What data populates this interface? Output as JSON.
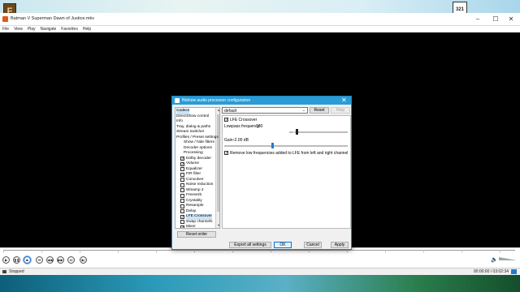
{
  "desktop": {
    "left_icon": "F",
    "right_icon": "321"
  },
  "window": {
    "title": "Batman V Superman Dawn of Justice.mkv",
    "icons": {
      "app": "mpc-app-icon",
      "minimize": "–",
      "maximize": "☐",
      "close": "✕"
    }
  },
  "menu": [
    "File",
    "View",
    "Play",
    "Navigate",
    "Favorites",
    "Help"
  ],
  "controls": {
    "buttons": [
      {
        "name": "play-button",
        "glyph": "▶"
      },
      {
        "name": "pause-button",
        "glyph": "❚❚"
      },
      {
        "name": "stop-button",
        "glyph": "■",
        "active": true
      },
      {
        "name": "previous-button",
        "glyph": "⏮"
      },
      {
        "name": "rewind-button",
        "glyph": "◀◀"
      },
      {
        "name": "forward-button",
        "glyph": "▶▶"
      },
      {
        "name": "next-button",
        "glyph": "⏭"
      },
      {
        "name": "frame-step-button",
        "glyph": "▶|"
      }
    ],
    "volume_icon": "🔈",
    "volume_level": 1.0
  },
  "status": {
    "state": "Stopped",
    "time": "00:00:00 / 03:02:34"
  },
  "dialog": {
    "title": "ffdshow audio processor configuration",
    "close_glyph": "✕",
    "tree": {
      "items": [
        {
          "label": "Codecs",
          "level": 1,
          "selected": true
        },
        {
          "label": "DirectShow control",
          "level": 1
        },
        {
          "label": "Info",
          "level": 1
        },
        {
          "label": "Tray, dialog & paths",
          "level": 1
        },
        {
          "label": "Stream switcher",
          "level": 1
        },
        {
          "label": "Profiles / Preset settings",
          "level": 1
        },
        {
          "label": "Show / hide filters",
          "level": 2
        },
        {
          "label": "Decoder options",
          "level": 2
        },
        {
          "label": "Processing",
          "level": 2
        },
        {
          "label": "Dolby decoder",
          "checkbox": true,
          "checked": true
        },
        {
          "label": "Volume",
          "checkbox": true,
          "checked": true
        },
        {
          "label": "Equalizer",
          "checkbox": true,
          "checked": false
        },
        {
          "label": "FIR filter",
          "checkbox": true,
          "checked": false
        },
        {
          "label": "Convolver",
          "checkbox": true,
          "checked": false
        },
        {
          "label": "Noise reduction",
          "checkbox": true,
          "checked": false
        },
        {
          "label": "Winamp 2",
          "checkbox": true,
          "checked": false
        },
        {
          "label": "Freeverb",
          "checkbox": true,
          "checked": false
        },
        {
          "label": "Crystality",
          "checkbox": true,
          "checked": false
        },
        {
          "label": "Resample",
          "checkbox": true,
          "checked": false
        },
        {
          "label": "Delay",
          "checkbox": true,
          "checked": false
        },
        {
          "label": "LFE Crossover",
          "checkbox": true,
          "checked": true,
          "selected": true
        },
        {
          "label": "Swap channels",
          "checkbox": true,
          "checked": false
        },
        {
          "label": "Mixer",
          "checkbox": true,
          "checked": true
        }
      ],
      "scroll_up": "▲",
      "scroll_down": "▼"
    },
    "reset_order_label": "Reset order",
    "preset": {
      "value": "default",
      "arrow": "⌄"
    },
    "reset_label": "Reset",
    "help_label": "Help",
    "lfe": {
      "enable_label": "LFE Crossover",
      "enabled": true,
      "lowpass_label": "Lowpass frequency:",
      "lowpass_value": "180",
      "lowpass_level": 0.12,
      "gain_label": "Gain:",
      "gain_value": "-2.00 dB",
      "gain_level": 0.39,
      "remove_low_label": "Remove low frequencies added to LFE from left and right channel",
      "remove_low_checked": true
    },
    "footer": {
      "export_label": "Export all settings",
      "ok_label": "OK",
      "cancel_label": "Cancel",
      "apply_label": "Apply"
    }
  }
}
